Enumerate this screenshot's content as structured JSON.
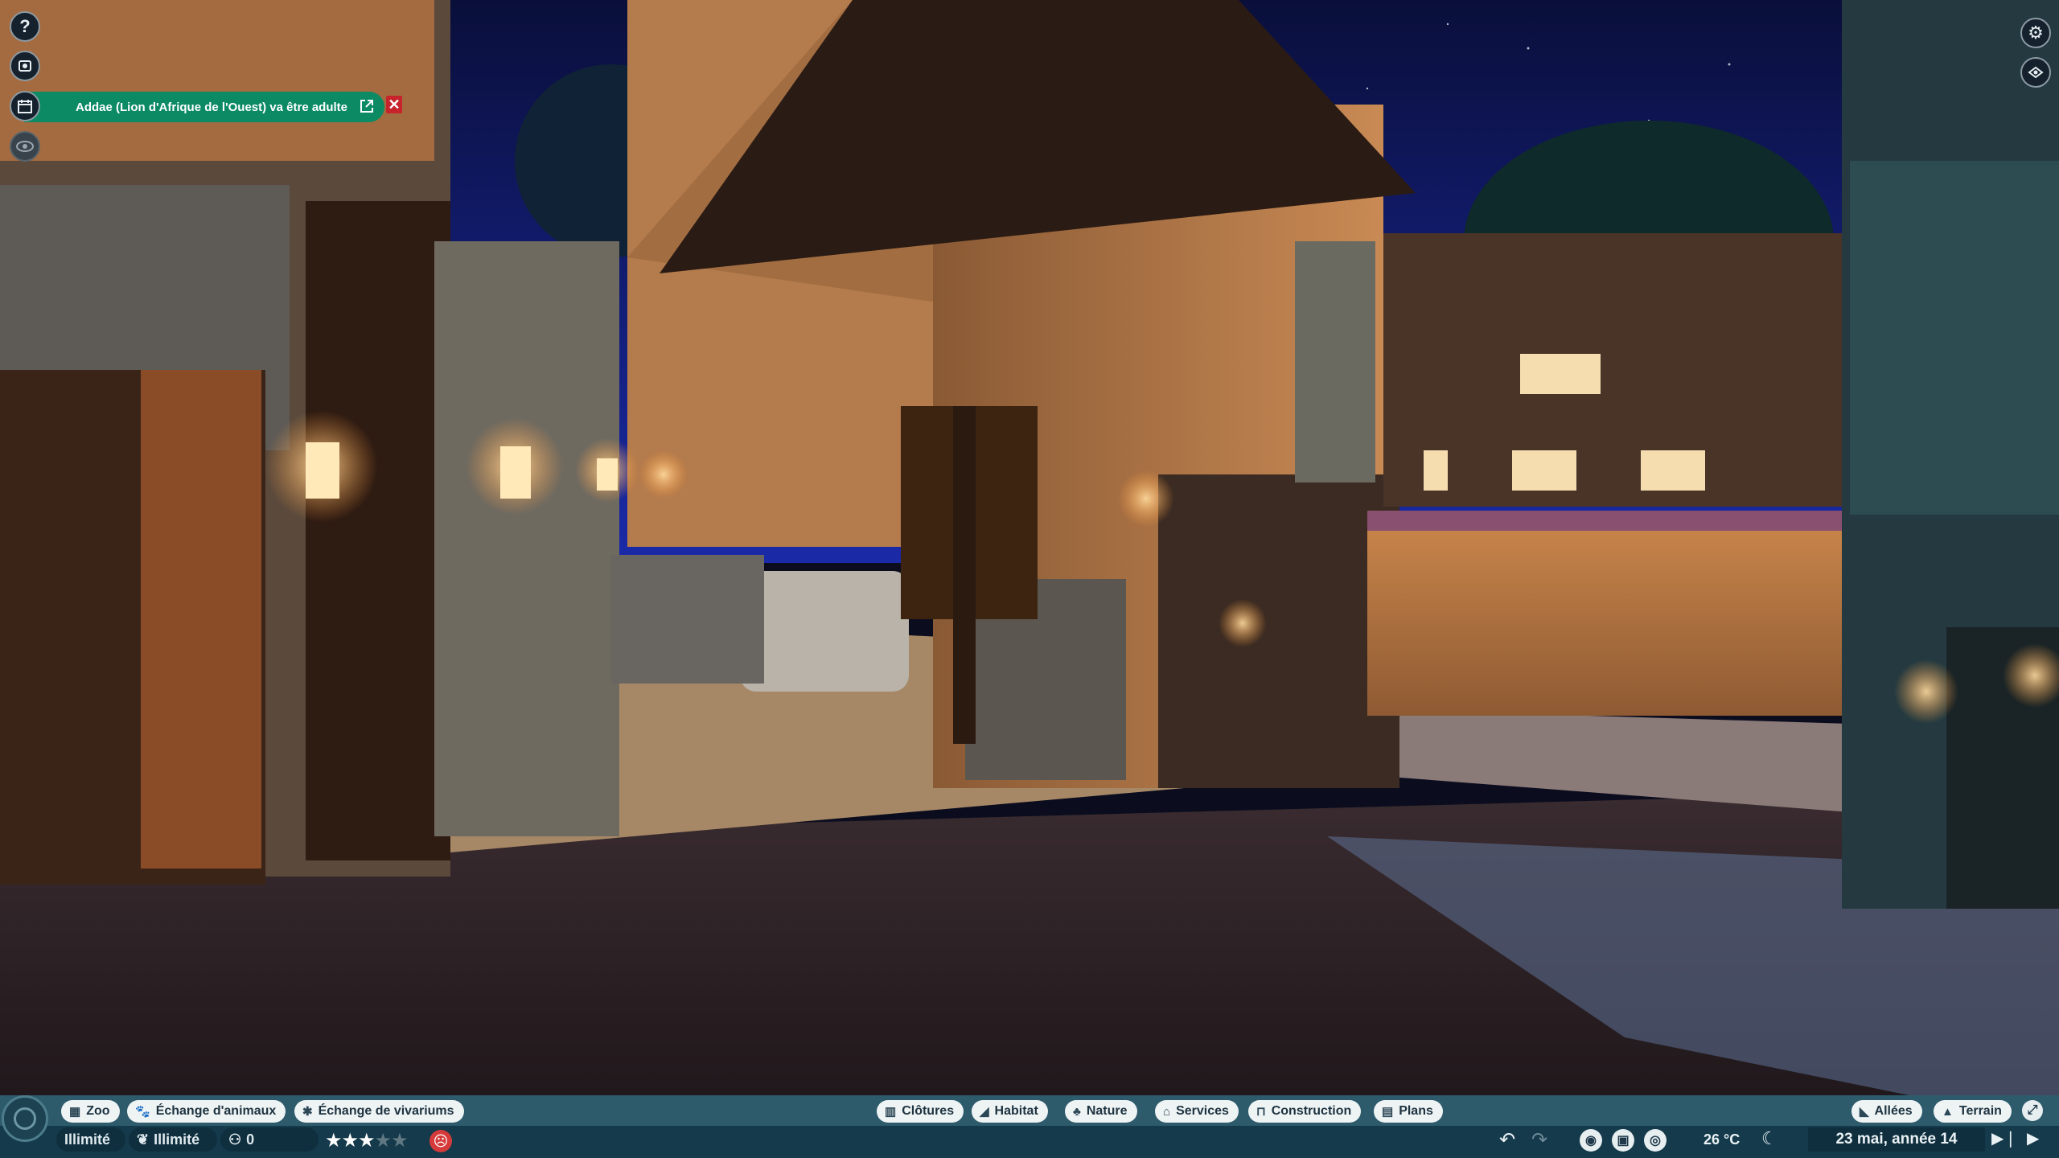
{
  "hud": {
    "left_buttons": [
      {
        "icon": "help-icon"
      },
      {
        "icon": "zoo-overview-icon"
      },
      {
        "icon": "calendar-icon"
      },
      {
        "icon": "view-icon"
      }
    ],
    "notification": {
      "text": "Addae (Lion d'Afrique de l'Ouest) va être adulte",
      "color": "#0b8a64",
      "close_color": "#c6232c"
    },
    "right_buttons": [
      {
        "icon": "settings-icon"
      },
      {
        "icon": "camera-view-icon"
      }
    ]
  },
  "toolbar": {
    "left": [
      {
        "label": "Zoo",
        "icon": "zoo-icon"
      },
      {
        "label": "Échange d'animaux",
        "icon": "paw-icon"
      },
      {
        "label": "Échange de vivariums",
        "icon": "bug-icon"
      }
    ],
    "center": [
      {
        "label": "Clôtures",
        "icon": "fence-icon"
      },
      {
        "label": "Habitat",
        "icon": "habitat-icon"
      },
      {
        "label": "Nature",
        "icon": "tree-icon"
      },
      {
        "label": "Services",
        "icon": "shop-icon"
      },
      {
        "label": "Construction",
        "icon": "construction-icon"
      },
      {
        "label": "Plans",
        "icon": "blueprint-icon"
      }
    ],
    "right": [
      {
        "label": "Allées",
        "icon": "path-icon"
      },
      {
        "label": "Terrain",
        "icon": "terrain-icon"
      }
    ]
  },
  "status": {
    "money": "Illimité",
    "research": "Illimité",
    "guests": "0",
    "rating_stars": 3,
    "rating_max": 5,
    "temperature": "26 °C",
    "date": "23 mai, année 14",
    "accent": "#2d5b6c"
  }
}
